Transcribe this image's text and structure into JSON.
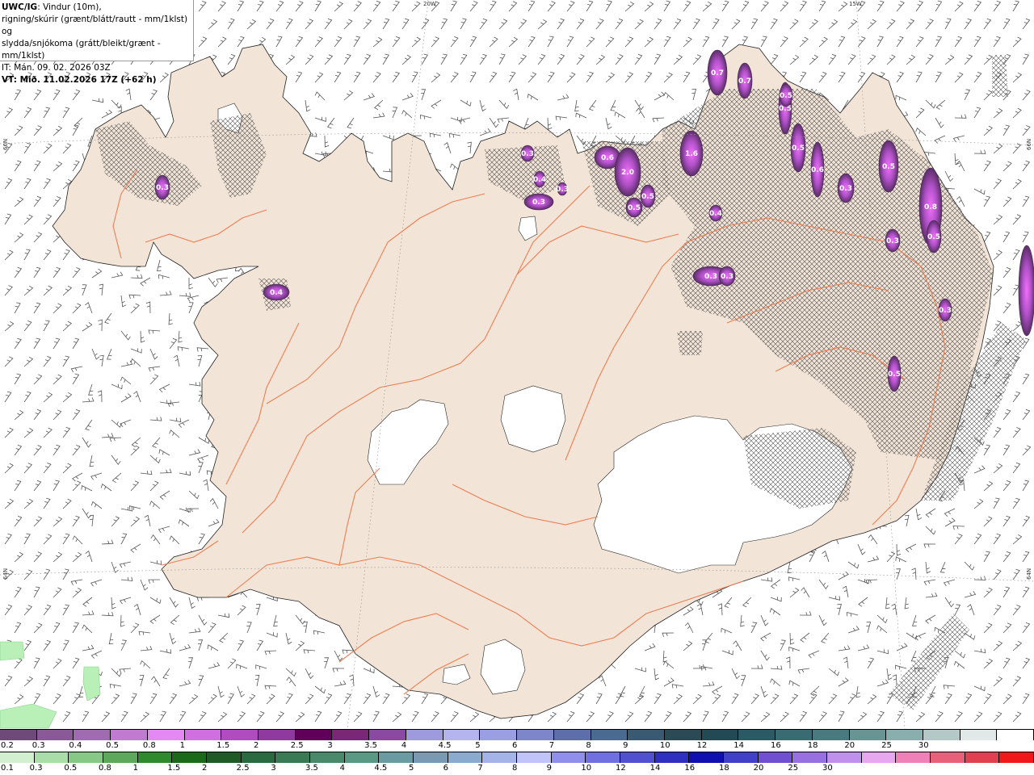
{
  "info": {
    "product": "UWC/IG",
    "line1_rest": ": Vindur (10m),",
    "line2": "rigning/skúrir (grænt/blátt/rautt - mm/1klst) og",
    "line3": "slydda/snjókoma (grátt/bleikt/grænt - mm/1klst)",
    "line4": "IT: Mán. 09. 02. 2026 03Z",
    "line5": "VT: Mið. 11.02.2026 17Z (+62 h)"
  },
  "graticule": {
    "top_labels": [
      "20W",
      "15W"
    ],
    "left_labels": [
      "66N",
      "64N"
    ],
    "right_labels": [
      "66N",
      "64N"
    ]
  },
  "precip_labels": [
    {
      "text": "0.3",
      "region": "Westfjords"
    },
    {
      "text": "0.4",
      "region": "Snæfellsnes"
    },
    {
      "text": "0.3",
      "region": "Skagi"
    },
    {
      "text": "0.4",
      "region": "Skagi"
    },
    {
      "text": "0.3",
      "region": "Skagi"
    },
    {
      "text": "0.3",
      "region": "Skagi"
    },
    {
      "text": "0.6",
      "region": "Tröllaskagi"
    },
    {
      "text": "2.0",
      "region": "Tröllaskagi"
    },
    {
      "text": "0.5",
      "region": "Tröllaskagi"
    },
    {
      "text": "0.5",
      "region": "Tröllaskagi"
    },
    {
      "text": "1.6",
      "region": "Eyjafjörður"
    },
    {
      "text": "0.4",
      "region": "Eyjafjörður"
    },
    {
      "text": "0.7",
      "region": "Grímsey"
    },
    {
      "text": "0.7",
      "region": "North coast"
    },
    {
      "text": "0.5",
      "region": "Tjörnes"
    },
    {
      "text": "0.5",
      "region": "Tjörnes"
    },
    {
      "text": "0.5",
      "region": "Tjörnes"
    },
    {
      "text": "0.6",
      "region": "Melrakkaslétta"
    },
    {
      "text": "0.3",
      "region": "Melrakkaslétta"
    },
    {
      "text": "0.5",
      "region": "Langanes"
    },
    {
      "text": "0.8",
      "region": "East fjords"
    },
    {
      "text": "0.5",
      "region": "East fjords"
    },
    {
      "text": "0.3",
      "region": "East fjords"
    },
    {
      "text": "0.3",
      "region": "Highlands"
    },
    {
      "text": "0.3",
      "region": "Highlands"
    },
    {
      "text": "0.3",
      "region": "East"
    },
    {
      "text": "0.5",
      "region": "East"
    }
  ],
  "legend": {
    "snow_colors": [
      "#6e4a78",
      "#8a5a96",
      "#a06cb0",
      "#c07ad0",
      "#e488f4",
      "#d070e0",
      "#b04cc0",
      "#903aa0",
      "#600058",
      "#7a2876",
      "#8a4aa2",
      "#9e9ade",
      "#b4b4ee",
      "#9a9ee2",
      "#7c86c8",
      "#5e6eaa",
      "#4a6a90",
      "#3a5a72",
      "#2c4a56",
      "#234a54",
      "#2c5a64",
      "#3a6a72",
      "#4a7a80",
      "#6a9494",
      "#8aaeae",
      "#b4c8c8",
      "#e0e8e8",
      "#ffffff"
    ],
    "snow_ticks": [
      "0.2",
      "0.3",
      "0.4",
      "0.5",
      "0.8",
      "1",
      "1.5",
      "2",
      "2.5",
      "3",
      "3.5",
      "4",
      "4.5",
      "5",
      "6",
      "7",
      "8",
      "9",
      "10",
      "12",
      "14",
      "16",
      "18",
      "20",
      "25",
      "30"
    ],
    "rain_colors": [
      "#d2f0d0",
      "#aadea8",
      "#88c886",
      "#5ea85c",
      "#2e8a2c",
      "#1a6a1a",
      "#205a24",
      "#2a6a40",
      "#3a7a54",
      "#4a8a6a",
      "#5a9a84",
      "#6a9aa2",
      "#7a9ab4",
      "#8aaace",
      "#a4b4e8",
      "#c0c4f8",
      "#9090ec",
      "#7070e0",
      "#5050d0",
      "#3030c0",
      "#1010b0",
      "#4040c8",
      "#7050d0",
      "#9870e0",
      "#c090ec",
      "#e8a8f0",
      "#f080b8",
      "#e8607a",
      "#e04050",
      "#f01818"
    ],
    "rain_ticks": [
      "0.1",
      "0.3",
      "0.5",
      "0.8",
      "1",
      "1.5",
      "2",
      "2.5",
      "3",
      "3.5",
      "4",
      "4.5",
      "5",
      "6",
      "7",
      "8",
      "9",
      "10",
      "12",
      "14",
      "16",
      "18",
      "20",
      "25",
      "30"
    ]
  }
}
